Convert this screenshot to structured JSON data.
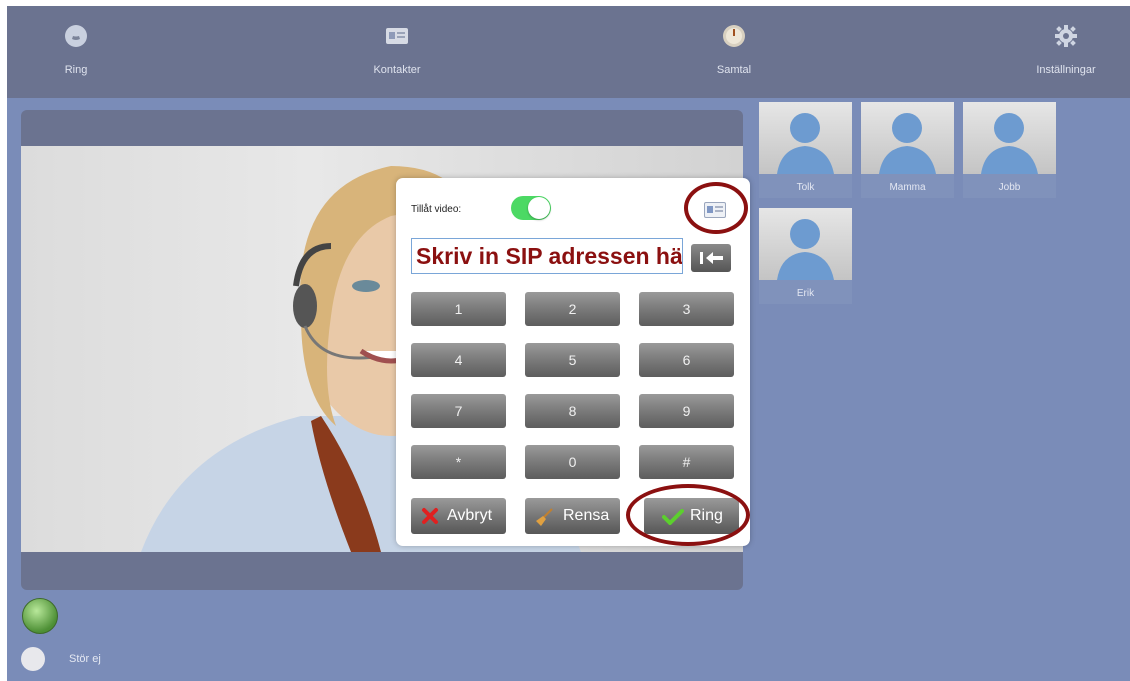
{
  "nav": {
    "items": [
      {
        "label": "Ring",
        "icon": "phone-icon"
      },
      {
        "label": "Kontakter",
        "icon": "contact-card-icon"
      },
      {
        "label": "Samtal",
        "icon": "clock-icon"
      },
      {
        "label": "Inställningar",
        "icon": "gear-icon"
      }
    ]
  },
  "contacts": [
    {
      "name": "Tolk"
    },
    {
      "name": "Mamma"
    },
    {
      "name": "Jobb"
    },
    {
      "name": "Erik"
    }
  ],
  "dialer": {
    "video_label": "Tillåt video:",
    "video_enabled": true,
    "sip_placeholder": "Skriv in SIP adressen här",
    "keys": [
      "1",
      "2",
      "3",
      "4",
      "5",
      "6",
      "7",
      "8",
      "9",
      "*",
      "0",
      "#"
    ],
    "cancel_label": "Avbryt",
    "clear_label": "Rensa",
    "call_label": "Ring"
  },
  "footer": {
    "dnd_label": "Stör ej"
  },
  "colors": {
    "highlight": "#8b1010",
    "toggle_on": "#4cd964",
    "background": "#7a8cb8"
  }
}
